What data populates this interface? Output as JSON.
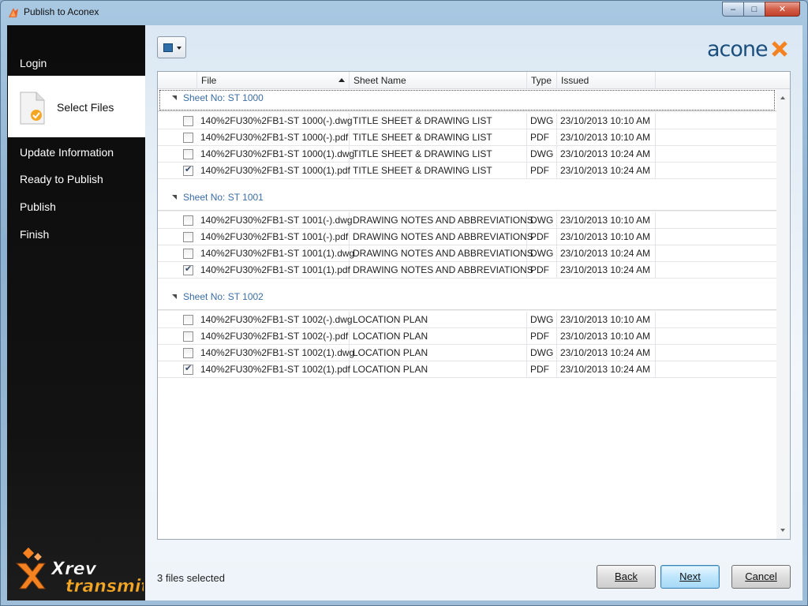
{
  "window": {
    "title": "Publish to Aconex"
  },
  "caption_buttons": {
    "minimize": "–",
    "maximize": "□",
    "close": "✕"
  },
  "sidebar": {
    "items": [
      {
        "label": "Login",
        "active": false
      },
      {
        "label": "Select Files",
        "active": true
      },
      {
        "label": "Update Information",
        "active": false
      },
      {
        "label": "Ready to Publish",
        "active": false
      },
      {
        "label": "Publish",
        "active": false
      },
      {
        "label": "Finish",
        "active": false
      }
    ],
    "brand": {
      "line1": "Xrev",
      "line2": "transmit"
    }
  },
  "logo": {
    "text": "aconex"
  },
  "grid": {
    "columns": [
      {
        "label": "File",
        "sorted": "ascending"
      },
      {
        "label": "Sheet Name"
      },
      {
        "label": "Type"
      },
      {
        "label": "Issued"
      }
    ],
    "groups": [
      {
        "header": "Sheet No: ST 1000",
        "rows": [
          {
            "checked": false,
            "file": "140%2FU30%2FB1-ST 1000(-).dwg",
            "sheet": "TITLE SHEET & DRAWING LIST",
            "type": "DWG",
            "issued": "23/10/2013 10:10 AM"
          },
          {
            "checked": false,
            "file": "140%2FU30%2FB1-ST 1000(-).pdf",
            "sheet": "TITLE SHEET & DRAWING LIST",
            "type": "PDF",
            "issued": "23/10/2013 10:10 AM"
          },
          {
            "checked": false,
            "file": "140%2FU30%2FB1-ST 1000(1).dwg",
            "sheet": "TITLE SHEET & DRAWING LIST",
            "type": "DWG",
            "issued": "23/10/2013 10:24 AM"
          },
          {
            "checked": true,
            "file": "140%2FU30%2FB1-ST 1000(1).pdf",
            "sheet": "TITLE SHEET & DRAWING LIST",
            "type": "PDF",
            "issued": "23/10/2013 10:24 AM"
          }
        ]
      },
      {
        "header": "Sheet No: ST 1001",
        "rows": [
          {
            "checked": false,
            "file": "140%2FU30%2FB1-ST 1001(-).dwg",
            "sheet": "DRAWING NOTES AND ABBREVIATIONS",
            "type": "DWG",
            "issued": "23/10/2013 10:10 AM"
          },
          {
            "checked": false,
            "file": "140%2FU30%2FB1-ST 1001(-).pdf",
            "sheet": "DRAWING NOTES AND ABBREVIATIONS",
            "type": "PDF",
            "issued": "23/10/2013 10:10 AM"
          },
          {
            "checked": false,
            "file": "140%2FU30%2FB1-ST 1001(1).dwg",
            "sheet": "DRAWING NOTES AND ABBREVIATIONS",
            "type": "DWG",
            "issued": "23/10/2013 10:24 AM"
          },
          {
            "checked": true,
            "file": "140%2FU30%2FB1-ST 1001(1).pdf",
            "sheet": "DRAWING NOTES AND ABBREVIATIONS",
            "type": "PDF",
            "issued": "23/10/2013 10:24 AM"
          }
        ]
      },
      {
        "header": "Sheet No: ST 1002",
        "rows": [
          {
            "checked": false,
            "file": "140%2FU30%2FB1-ST 1002(-).dwg",
            "sheet": "LOCATION PLAN",
            "type": "DWG",
            "issued": "23/10/2013 10:10 AM"
          },
          {
            "checked": false,
            "file": "140%2FU30%2FB1-ST 1002(-).pdf",
            "sheet": "LOCATION PLAN",
            "type": "PDF",
            "issued": "23/10/2013 10:10 AM"
          },
          {
            "checked": false,
            "file": "140%2FU30%2FB1-ST 1002(1).dwg",
            "sheet": "LOCATION PLAN",
            "type": "DWG",
            "issued": "23/10/2013 10:24 AM"
          },
          {
            "checked": true,
            "file": "140%2FU30%2FB1-ST 1002(1).pdf",
            "sheet": "LOCATION PLAN",
            "type": "PDF",
            "issued": "23/10/2013 10:24 AM"
          }
        ]
      }
    ]
  },
  "footer": {
    "status": "3 files selected",
    "back_label": "Back",
    "next_label": "Next",
    "cancel_label": "Cancel"
  },
  "colors": {
    "accent": "#3b6da6",
    "sidebar_bg": "#111111",
    "brand_orange": "#f58220"
  }
}
